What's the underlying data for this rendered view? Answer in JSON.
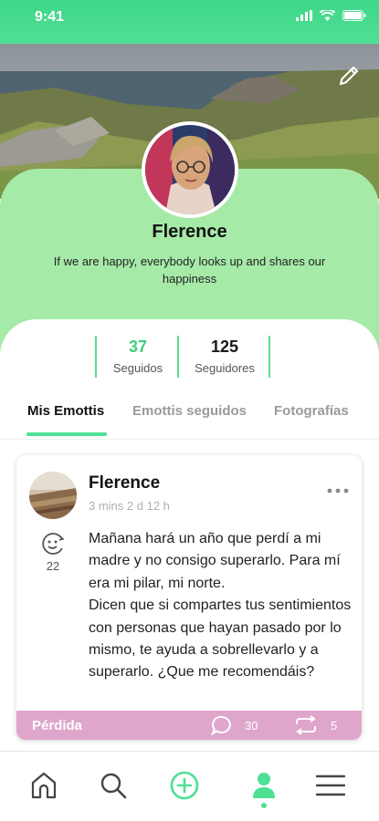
{
  "status_bar": {
    "time": "9:41"
  },
  "profile": {
    "name": "Flerence",
    "bio": "If we are happy, everybody looks up and shares our happiness"
  },
  "stats": [
    {
      "value": "37",
      "label": "Seguidos"
    },
    {
      "value": "125",
      "label": "Seguidores"
    }
  ],
  "tabs": [
    {
      "label": "Mis Emottis",
      "active": true
    },
    {
      "label": "Emottis seguidos",
      "active": false
    },
    {
      "label": "Fotografías",
      "active": false
    }
  ],
  "post": {
    "author": "Flerence",
    "time": "3 mins 2 d 12 h",
    "emoji_count": "22",
    "body": "Mañana hará un año que perdí a mi madre y no consigo superarlo. Para mí era mi pilar, mi norte.\nDicen que si compartes tus sentimientos con personas que hayan pasado por lo mismo, te ayuda a sobrellevarlo y a superarlo. ¿Que me recomendáis?",
    "tag": "Pérdida",
    "comments": "30",
    "shares": "5"
  },
  "nav": {
    "items": [
      "home-icon",
      "search-icon",
      "add-circle-icon",
      "profile-icon",
      "menu-icon"
    ],
    "active": "profile-icon"
  },
  "colors": {
    "accent": "#4ee094",
    "panel": "#a6eaa8",
    "tag_bar": "#dfa6cc"
  }
}
